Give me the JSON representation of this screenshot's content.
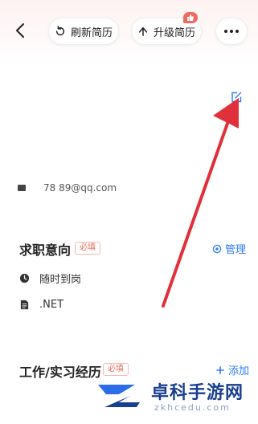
{
  "header": {
    "refresh_label": "刷新简历",
    "upgrade_label": "升级简历"
  },
  "contact": {
    "text": "78 89@qq.com"
  },
  "intention": {
    "title": "求职意向",
    "required": "必填",
    "manage_label": "管理",
    "items": [
      {
        "icon": "clock-icon",
        "text": "随时到岗"
      },
      {
        "icon": "document-icon",
        "text": ".NET"
      }
    ]
  },
  "experience": {
    "title": "工作/实习经历",
    "required": "必填",
    "add_label": "添加"
  },
  "watermark": {
    "name": "卓科手游网",
    "domain": "zkhcedu.com"
  },
  "colors": {
    "accent": "#2f7df6",
    "required": "#e86a5a",
    "arrow": "#e0303c"
  }
}
